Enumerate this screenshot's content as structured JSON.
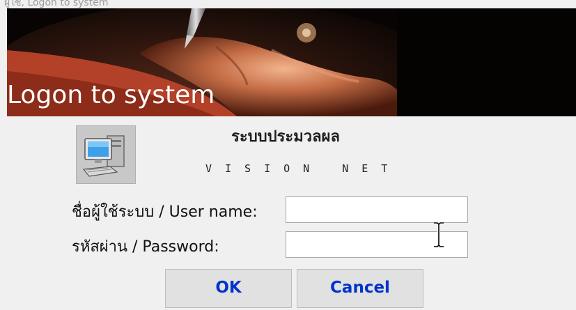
{
  "window": {
    "title": "ผู้ใช้, Logon to system"
  },
  "banner": {
    "title": "Logon to system",
    "icon": "hand-with-pen"
  },
  "header": {
    "icon": "computer-icon",
    "system_name": "ระบบประมวลผล",
    "subtitle": "VISION NET"
  },
  "form": {
    "username_label": "ชื่อผู้ใช้ระบบ / User name:",
    "username_value": "",
    "password_label": "รหัสผ่าน / Password:",
    "password_value": ""
  },
  "buttons": {
    "ok_label": "OK",
    "cancel_label": "Cancel"
  },
  "colors": {
    "button_text": "#0033cc",
    "background": "#f0f0f0",
    "banner_background": "#0a0605"
  },
  "cursor": "text-cursor-icon"
}
